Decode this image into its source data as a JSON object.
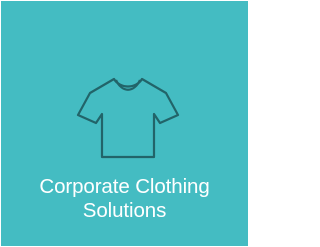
{
  "tile": {
    "icon": "t-shirt-icon",
    "title_line1": "Corporate Clothing",
    "title_line2": "Solutions",
    "colors": {
      "background": "#44bcc2",
      "icon_stroke": "#226469",
      "text": "#ffffff"
    }
  }
}
